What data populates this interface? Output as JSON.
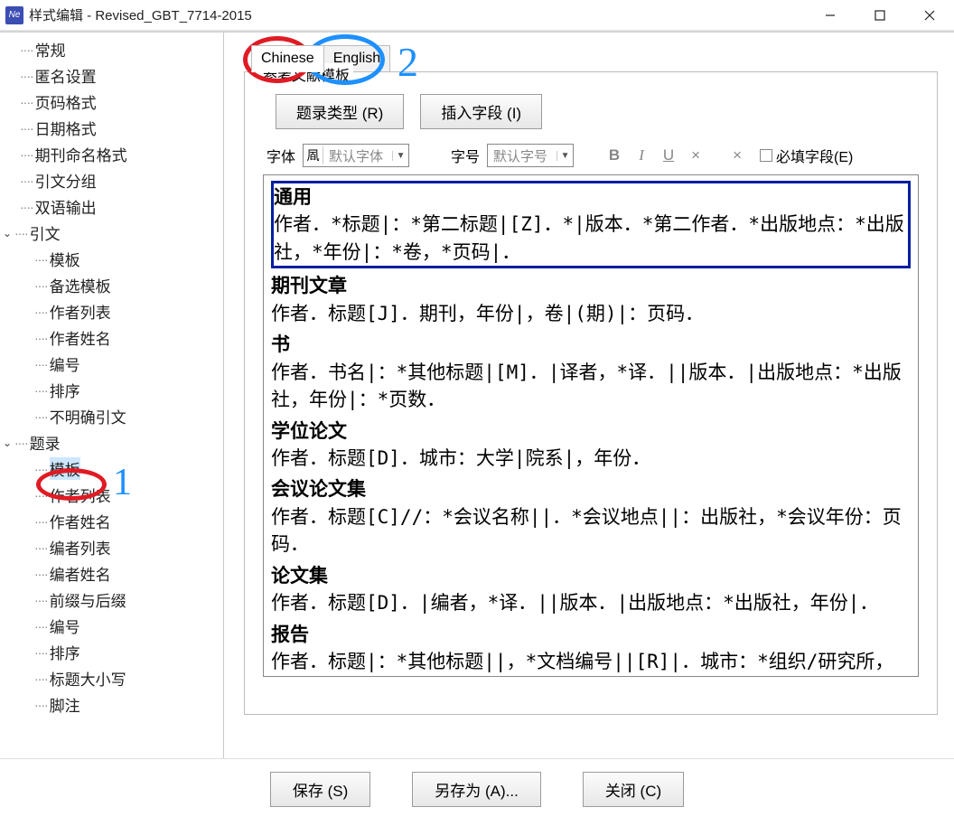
{
  "window": {
    "title": "样式编辑 - Revised_GBT_7714-2015"
  },
  "sidebar": {
    "items": [
      {
        "label": "常规",
        "level": 1
      },
      {
        "label": "匿名设置",
        "level": 1
      },
      {
        "label": "页码格式",
        "level": 1
      },
      {
        "label": "日期格式",
        "level": 1
      },
      {
        "label": "期刊命名格式",
        "level": 1
      },
      {
        "label": "引文分组",
        "level": 1
      },
      {
        "label": "双语输出",
        "level": 1
      },
      {
        "label": "引文",
        "level": 1,
        "expandable": true
      },
      {
        "label": "模板",
        "level": 2
      },
      {
        "label": "备选模板",
        "level": 2
      },
      {
        "label": "作者列表",
        "level": 2
      },
      {
        "label": "作者姓名",
        "level": 2
      },
      {
        "label": "编号",
        "level": 2
      },
      {
        "label": "排序",
        "level": 2
      },
      {
        "label": "不明确引文",
        "level": 2
      },
      {
        "label": "题录",
        "level": 1,
        "expandable": true
      },
      {
        "label": "模板",
        "level": 2,
        "selected": true
      },
      {
        "label": "作者列表",
        "level": 2
      },
      {
        "label": "作者姓名",
        "level": 2
      },
      {
        "label": "编者列表",
        "level": 2
      },
      {
        "label": "编者姓名",
        "level": 2
      },
      {
        "label": "前缀与后缀",
        "level": 2
      },
      {
        "label": "编号",
        "level": 2
      },
      {
        "label": "排序",
        "level": 2
      },
      {
        "label": "标题大小写",
        "level": 2
      },
      {
        "label": "脚注",
        "level": 2
      }
    ]
  },
  "tabs": {
    "chinese": "Chinese",
    "english": "English"
  },
  "panel": {
    "title": "参考文献模板",
    "btn_record_type": "题录类型 (R)",
    "btn_insert_field": "插入字段 (I)"
  },
  "toolbar": {
    "font_label": "字体",
    "font_value": "默认字体",
    "size_label": "字号",
    "size_value": "默认字号",
    "required_field": "必填字段(E)"
  },
  "templates": [
    {
      "title": "通用",
      "body": "作者．*标题|：*第二标题|[Z]．*|版本．*第二作者．*出版地点：*出版社，*年份|：*卷，*页码|．",
      "selected": true
    },
    {
      "title": "期刊文章",
      "body": "作者．标题[J]．期刊，年份|，卷|(期)|：页码．"
    },
    {
      "title": "书",
      "body": "作者．书名|：*其他标题|[M]．|译者，*译．||版本．|出版地点：*出版社，年份|：*页数．"
    },
    {
      "title": "学位论文",
      "body": "作者．标题[D]．城市：大学|院系|，年份．"
    },
    {
      "title": "会议论文集",
      "body": "作者．标题[C]//：*会议名称||．*会议地点||：出版社，*会议年份：页码．"
    },
    {
      "title": "论文集",
      "body": "作者．标题[D]．|编者，*译．||版本．|出版地点：*出版社，年份|．"
    },
    {
      "title": "报告",
      "body": "作者．标题|：*其他标题||，*文档编号||[R]|．城市：*组织/研究所，年份|．"
    }
  ],
  "footer": {
    "save": "保存 (S)",
    "saveas": "另存为 (A)...",
    "close": "关闭 (C)"
  },
  "annotations": {
    "num1": "1",
    "num2": "2"
  }
}
